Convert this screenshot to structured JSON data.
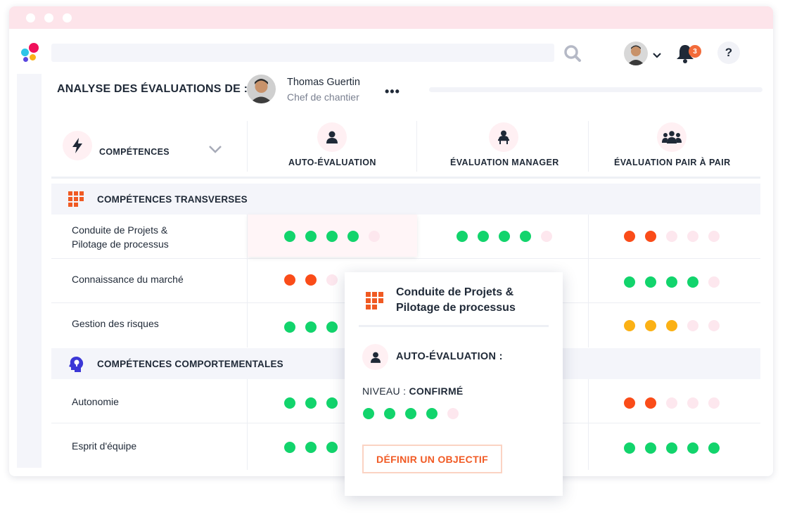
{
  "header": {
    "title": "ANALYSE DES ÉVALUATIONS DE :",
    "user_name": "Thomas Guertin",
    "user_role": "Chef de chantier",
    "more": "•••",
    "notifications_count": "3",
    "help": "?"
  },
  "columns": {
    "competences": "COMPÉTENCES",
    "self": "AUTO-ÉVALUATION",
    "manager": "ÉVALUATION MANAGER",
    "peer": "ÉVALUATION PAIR À PAIR"
  },
  "sections": [
    {
      "label": "COMPÉTENCES TRANSVERSES",
      "rows": [
        {
          "label": "Conduite de Projets &\nPilotage de processus",
          "self": [
            1,
            1,
            1,
            1,
            0
          ],
          "self_color": "green",
          "manager": [
            1,
            1,
            1,
            1,
            0
          ],
          "manager_color": "green",
          "peer": [
            1,
            1,
            0,
            0,
            0
          ],
          "peer_color": "red"
        },
        {
          "label": "Connaissance du marché",
          "self": [
            1,
            1,
            0
          ],
          "self_color": "red",
          "peer": [
            1,
            1,
            1,
            1,
            0
          ],
          "peer_color": "green"
        },
        {
          "label": "Gestion des risques",
          "self": [
            1,
            1,
            1
          ],
          "self_color": "green",
          "peer": [
            1,
            1,
            1,
            0,
            0
          ],
          "peer_color": "yellow"
        }
      ]
    },
    {
      "label": "COMPÉTENCES COMPORTEMENTALES",
      "rows": [
        {
          "label": "Autonomie",
          "self": [
            1,
            1,
            1
          ],
          "self_color": "green",
          "peer": [
            1,
            1,
            0,
            0,
            0
          ],
          "peer_color": "red"
        },
        {
          "label": "Esprit d'équipe",
          "self": [
            1,
            1,
            1
          ],
          "self_color": "green",
          "peer": [
            1,
            1,
            1,
            1,
            1
          ],
          "peer_color": "green"
        }
      ]
    }
  ],
  "popup": {
    "title_line1": "Conduite de Projets &",
    "title_line2": "Pilotage de processus",
    "auto_label": "AUTO-ÉVALUATION :",
    "level_prefix": "NIVEAU : ",
    "level_value": "CONFIRMÉ",
    "level_dots": [
      1,
      1,
      1,
      1,
      0
    ],
    "button": "DÉFINIR UN OBJECTIF"
  },
  "colors": {
    "green": "#12d46c",
    "red": "#fa4c19",
    "yellow": "#fbb115",
    "empty": "#fde7ee",
    "accent": "#f15a24"
  },
  "icons": {
    "logo": "app-logo",
    "search": "search-icon",
    "bell": "bell-icon",
    "competences": "lightning-icon",
    "self": "person-icon",
    "manager": "manager-icon",
    "peer": "group-icon",
    "transverse": "grid-icon",
    "behavioural": "head-brain-icon"
  }
}
